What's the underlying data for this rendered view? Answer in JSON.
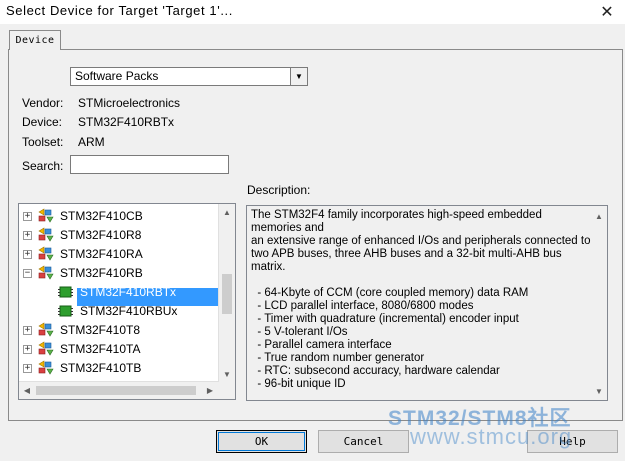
{
  "window": {
    "title": "Select Device for Target 'Target 1'...",
    "close_glyph": "✕"
  },
  "tabs": [
    {
      "label": "Device",
      "active": true
    }
  ],
  "source_combo": {
    "value": "Software Packs",
    "arrow": "▼"
  },
  "info": {
    "vendor_label": "Vendor:",
    "vendor_value": "STMicroelectronics",
    "device_label": "Device:",
    "device_value": "STM32F410RBTx",
    "toolset_label": "Toolset:",
    "toolset_value": "ARM",
    "search_label": "Search:",
    "search_value": ""
  },
  "tree": {
    "items": [
      {
        "label": "STM32F410CB",
        "level": 0,
        "expander": "+",
        "icon": "device-group-icon"
      },
      {
        "label": "STM32F410R8",
        "level": 0,
        "expander": "+",
        "icon": "device-group-icon"
      },
      {
        "label": "STM32F410RA",
        "level": 0,
        "expander": "+",
        "icon": "device-group-icon"
      },
      {
        "label": "STM32F410RB",
        "level": 0,
        "expander": "−",
        "icon": "device-group-icon"
      },
      {
        "label": "STM32F410RBTx",
        "level": 1,
        "expander": "",
        "icon": "chip-icon",
        "selected": true
      },
      {
        "label": "STM32F410RBUx",
        "level": 1,
        "expander": "",
        "icon": "chip-icon"
      },
      {
        "label": "STM32F410T8",
        "level": 0,
        "expander": "+",
        "icon": "device-group-icon"
      },
      {
        "label": "STM32F410TA",
        "level": 0,
        "expander": "+",
        "icon": "device-group-icon"
      },
      {
        "label": "STM32F410TB",
        "level": 0,
        "expander": "+",
        "icon": "device-group-icon"
      }
    ]
  },
  "description": {
    "label": "Description:",
    "text": "The STM32F4 family incorporates high-speed embedded memories and\nan extensive range of enhanced I/Os and peripherals connected to\ntwo APB buses, three AHB buses and a 32-bit multi-AHB bus matrix.\n\n  - 64-Kbyte of CCM (core coupled memory) data RAM\n  - LCD parallel interface, 8080/6800 modes\n  - Timer with quadrature (incremental) encoder input\n  - 5 V-tolerant I/Os\n  - Parallel camera interface\n  - True random number generator\n  - RTC: subsecond accuracy, hardware calendar\n  - 96-bit unique ID"
  },
  "buttons": {
    "ok": "OK",
    "cancel": "Cancel",
    "help": "Help"
  },
  "watermark": {
    "line1": "STM32/STM8社区",
    "line2": "www.stmcu.org"
  },
  "colors": {
    "selection": "#3399ff",
    "chip_green": "#2e9e2e"
  }
}
